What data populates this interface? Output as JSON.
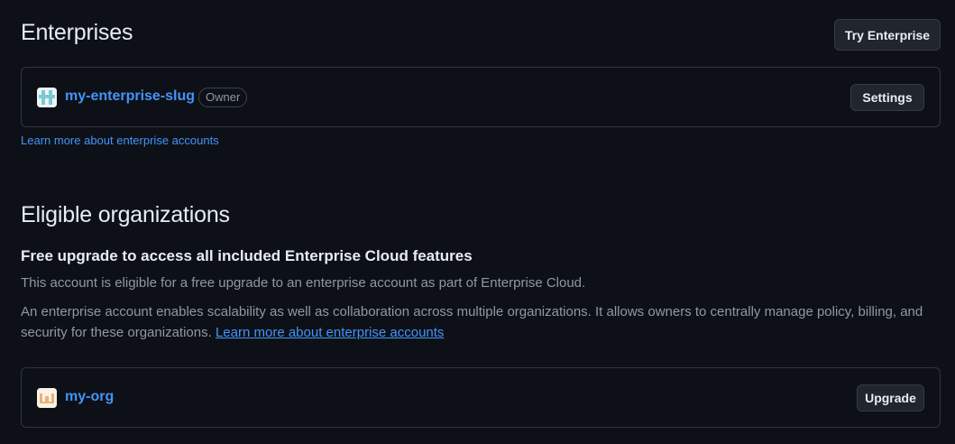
{
  "enterprises": {
    "title": "Enterprises",
    "try_button": "Try Enterprise",
    "item": {
      "name": "my-enterprise-slug",
      "role": "Owner",
      "settings_button": "Settings"
    },
    "learn_more": "Learn more about enterprise accounts"
  },
  "eligible": {
    "title": "Eligible organizations",
    "subtitle": "Free upgrade to access all included Enterprise Cloud features",
    "para1": "This account is eligible for a free upgrade to an enterprise account as part of Enterprise Cloud.",
    "para2": "An enterprise account enables scalability as well as collaboration across multiple organizations. It allows owners to centrally manage policy, billing, and security for these organizations.",
    "para2_link": "Learn more about enterprise accounts",
    "item": {
      "name": "my-org",
      "upgrade_button": "Upgrade"
    }
  },
  "colors": {
    "background": "#0d1117",
    "link": "#4493f8",
    "border": "#30363d"
  }
}
